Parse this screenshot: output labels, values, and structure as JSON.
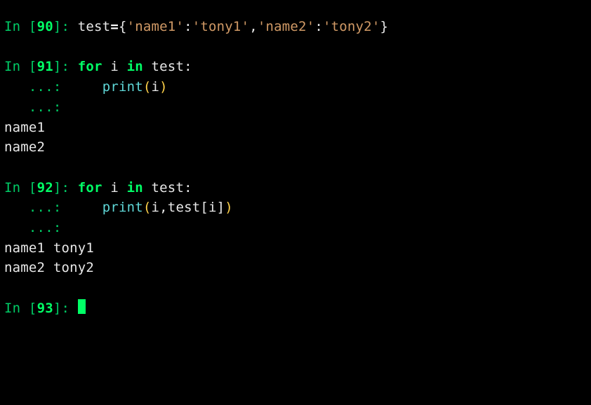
{
  "cells": [
    {
      "n": "90",
      "segments": [
        {
          "cls": "w",
          "t": "test"
        },
        {
          "cls": "wb",
          "t": "="
        },
        {
          "cls": "w",
          "t": "{"
        },
        {
          "cls": "o",
          "t": "'name1'"
        },
        {
          "cls": "w",
          "t": ":"
        },
        {
          "cls": "o",
          "t": "'tony1'"
        },
        {
          "cls": "w",
          "t": ","
        },
        {
          "cls": "o",
          "t": "'name2'"
        },
        {
          "cls": "w",
          "t": ":"
        },
        {
          "cls": "o",
          "t": "'tony2'"
        },
        {
          "cls": "w",
          "t": "}"
        }
      ],
      "continuations": [],
      "output": []
    },
    {
      "n": "91",
      "segments": [
        {
          "cls": "gb",
          "t": "for"
        },
        {
          "cls": "w",
          "t": " i "
        },
        {
          "cls": "gb",
          "t": "in"
        },
        {
          "cls": "w",
          "t": " test:"
        }
      ],
      "continuations": [
        [
          {
            "cls": "w",
            "t": "    "
          },
          {
            "cls": "c",
            "t": "print"
          },
          {
            "cls": "y",
            "t": "("
          },
          {
            "cls": "w",
            "t": "i"
          },
          {
            "cls": "y",
            "t": ")"
          }
        ],
        []
      ],
      "output": [
        "name1",
        "name2"
      ]
    },
    {
      "n": "92",
      "segments": [
        {
          "cls": "gb",
          "t": "for"
        },
        {
          "cls": "w",
          "t": " i "
        },
        {
          "cls": "gb",
          "t": "in"
        },
        {
          "cls": "w",
          "t": " test:"
        }
      ],
      "continuations": [
        [
          {
            "cls": "w",
            "t": "    "
          },
          {
            "cls": "c",
            "t": "print"
          },
          {
            "cls": "y",
            "t": "("
          },
          {
            "cls": "w",
            "t": "i,test[i]"
          },
          {
            "cls": "y",
            "t": ")"
          }
        ],
        []
      ],
      "output": [
        "name1 tony1",
        "name2 tony2"
      ]
    }
  ],
  "next_prompt_n": "93",
  "prompt": {
    "in_prefix": "In [",
    "in_suffix": "]: ",
    "cont": "   ...: "
  }
}
